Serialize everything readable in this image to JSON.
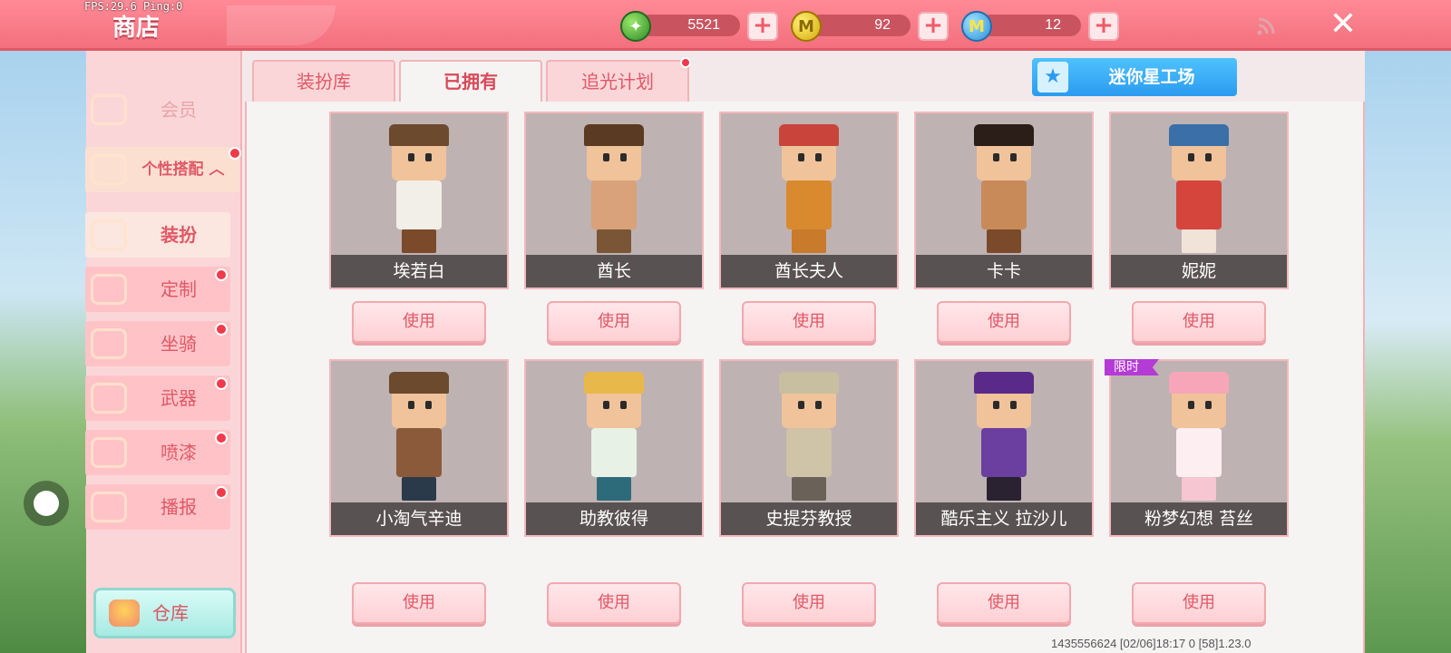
{
  "status": {
    "fps": "FPS:29.6",
    "ping": "Ping:0"
  },
  "window": {
    "title": "商店"
  },
  "currency": [
    {
      "name": "gem",
      "value": "5521"
    },
    {
      "name": "coin",
      "value": "92"
    },
    {
      "name": "mini-coin",
      "value": "12"
    }
  ],
  "sidebar": {
    "member": "会员",
    "group": "个性搭配",
    "items": [
      {
        "label": "装扮",
        "active": true,
        "dot": false
      },
      {
        "label": "定制",
        "active": false,
        "dot": true
      },
      {
        "label": "坐骑",
        "active": false,
        "dot": true
      },
      {
        "label": "武器",
        "active": false,
        "dot": true
      },
      {
        "label": "喷漆",
        "active": false,
        "dot": true
      },
      {
        "label": "播报",
        "active": false,
        "dot": true
      }
    ],
    "warehouse": "仓库"
  },
  "tabs": [
    {
      "label": "装扮库",
      "active": false
    },
    {
      "label": "已拥有",
      "active": true
    },
    {
      "label": "追光计划",
      "active": false
    }
  ],
  "mini_star_button": "迷你星工场",
  "use_label": "使用",
  "limited_label": "限时",
  "cards": [
    {
      "name": "埃若白",
      "hair": "#f3c23a",
      "body": "#f2eee8",
      "legs": "#7a4a2a",
      "hat": "#6b4a2e"
    },
    {
      "name": "酋长",
      "hair": "#5a3a22",
      "body": "#d9a27a",
      "legs": "#7a5636",
      "hat": "#5a3a22"
    },
    {
      "name": "酋长夫人",
      "hair": "#c9453c",
      "body": "#d98a2e",
      "legs": "#c97a2a",
      "hat": "#c9453c"
    },
    {
      "name": "卡卡",
      "hair": "#2b1e18",
      "body": "#c98a5a",
      "legs": "#7a4a2a",
      "hat": "#2b1e18"
    },
    {
      "name": "妮妮",
      "hair": "#2b1e18",
      "body": "#d5453c",
      "legs": "#f1e3d8",
      "hat": "#3a6fa8"
    },
    {
      "name": "小淘气辛迪",
      "hair": "#a4502a",
      "body": "#8a5a3a",
      "legs": "#2b3a4a",
      "hat": "#6b4a2e"
    },
    {
      "name": "助教彼得",
      "hair": "#e8b84a",
      "body": "#e8f1e6",
      "legs": "#2e6b7a",
      "hat": "#e8b84a"
    },
    {
      "name": "史提芬教授",
      "hair": "#d9d0c0",
      "body": "#cfc3a8",
      "legs": "#6a6258",
      "hat": "#c8bea0"
    },
    {
      "name": "酷乐主义 拉沙儿",
      "hair": "#2a2230",
      "body": "#6a3fa0",
      "legs": "#2a2230",
      "hat": "#5a2a8a"
    },
    {
      "name": "粉梦幻想 苔丝",
      "hair": "#f6a6b8",
      "body": "#fdeef2",
      "legs": "#f6c6d2",
      "hat": "#f6a6b8"
    }
  ],
  "footer": {
    "id_text": "1435556624    [02/06]18:17 0    [58]1.23.0"
  }
}
